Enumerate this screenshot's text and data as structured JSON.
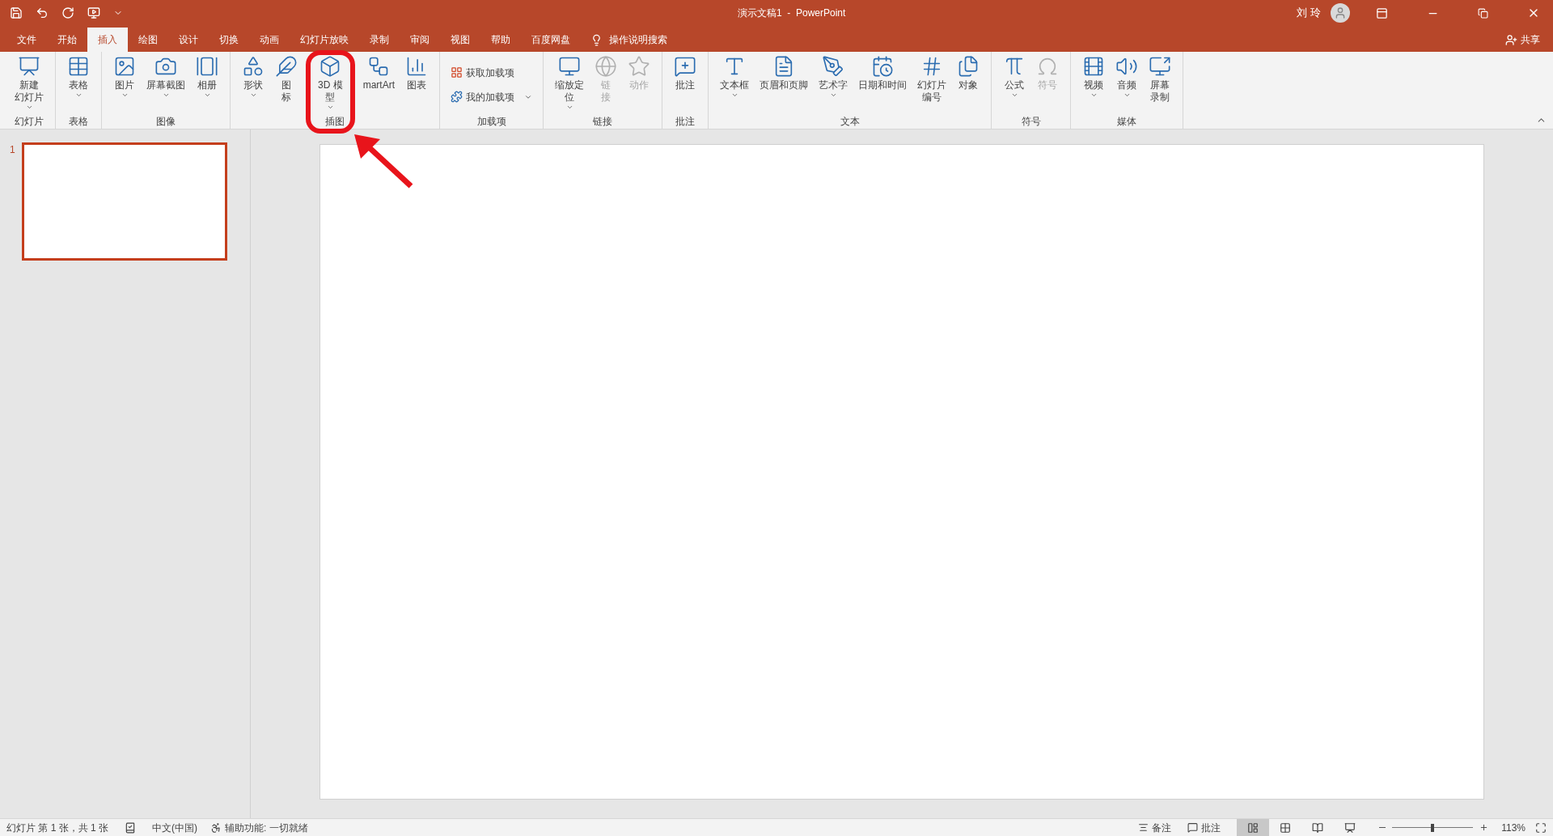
{
  "window": {
    "title": "演示文稿1  -  PowerPoint",
    "user": "刘 玲"
  },
  "tabs": [
    {
      "label": "文件",
      "selected": false
    },
    {
      "label": "开始",
      "selected": false
    },
    {
      "label": "插入",
      "selected": true
    },
    {
      "label": "绘图",
      "selected": false
    },
    {
      "label": "设计",
      "selected": false
    },
    {
      "label": "切换",
      "selected": false
    },
    {
      "label": "动画",
      "selected": false
    },
    {
      "label": "幻灯片放映",
      "selected": false
    },
    {
      "label": "录制",
      "selected": false
    },
    {
      "label": "审阅",
      "selected": false
    },
    {
      "label": "视图",
      "selected": false
    },
    {
      "label": "帮助",
      "selected": false
    },
    {
      "label": "百度网盘",
      "selected": false
    }
  ],
  "search": {
    "placeholder": "操作说明搜索"
  },
  "share": "共享",
  "ribbon": [
    {
      "label": "幻灯片",
      "buttons": [
        {
          "kind": "large",
          "lines": [
            "新建",
            "幻灯片"
          ],
          "dropdown": true,
          "disabled": false,
          "highlighted": false
        }
      ]
    },
    {
      "label": "表格",
      "buttons": [
        {
          "kind": "large",
          "lines": [
            "表格"
          ],
          "dropdown": true,
          "disabled": false,
          "highlighted": false
        }
      ]
    },
    {
      "label": "图像",
      "buttons": [
        {
          "kind": "large",
          "lines": [
            "图片"
          ],
          "dropdown": true,
          "disabled": false,
          "highlighted": false
        },
        {
          "kind": "large",
          "lines": [
            "屏幕截图"
          ],
          "dropdown": true,
          "disabled": false,
          "highlighted": false
        },
        {
          "kind": "large",
          "lines": [
            "相册"
          ],
          "dropdown": true,
          "disabled": false,
          "highlighted": false
        }
      ]
    },
    {
      "label": "插图",
      "buttons": [
        {
          "kind": "large",
          "lines": [
            "形状"
          ],
          "dropdown": true,
          "disabled": false,
          "highlighted": false
        },
        {
          "kind": "large",
          "lines": [
            "图",
            "标"
          ],
          "dropdown": false,
          "disabled": false,
          "highlighted": false
        },
        {
          "kind": "large",
          "lines": [
            "3D 模",
            "型"
          ],
          "dropdown": true,
          "disabled": false,
          "highlighted": true
        },
        {
          "kind": "large",
          "lines": [
            "martArt"
          ],
          "dropdown": false,
          "disabled": false,
          "highlighted": false
        },
        {
          "kind": "large",
          "lines": [
            "图表"
          ],
          "dropdown": false,
          "disabled": false,
          "highlighted": false
        }
      ]
    },
    {
      "label": "加载项",
      "buttons": [
        {
          "kind": "small",
          "lines": [
            "获取加载项"
          ],
          "dropdown": false,
          "disabled": false,
          "highlighted": false
        },
        {
          "kind": "small",
          "lines": [
            "我的加载项"
          ],
          "dropdown": true,
          "disabled": false,
          "highlighted": false
        }
      ]
    },
    {
      "label": "链接",
      "buttons": [
        {
          "kind": "large",
          "lines": [
            "缩放定",
            "位"
          ],
          "dropdown": true,
          "disabled": false,
          "highlighted": false
        },
        {
          "kind": "large",
          "lines": [
            "链",
            "接"
          ],
          "dropdown": false,
          "disabled": true,
          "highlighted": false
        },
        {
          "kind": "large",
          "lines": [
            "动作"
          ],
          "dropdown": false,
          "disabled": true,
          "highlighted": false
        }
      ]
    },
    {
      "label": "批注",
      "buttons": [
        {
          "kind": "large",
          "lines": [
            "批注"
          ],
          "dropdown": false,
          "disabled": false,
          "highlighted": false
        }
      ]
    },
    {
      "label": "文本",
      "buttons": [
        {
          "kind": "large",
          "lines": [
            "文本框"
          ],
          "dropdown": true,
          "disabled": false,
          "highlighted": false
        },
        {
          "kind": "large",
          "lines": [
            "页眉和页脚"
          ],
          "dropdown": false,
          "disabled": false,
          "highlighted": false
        },
        {
          "kind": "large",
          "lines": [
            "艺术字"
          ],
          "dropdown": true,
          "disabled": false,
          "highlighted": false
        },
        {
          "kind": "large",
          "lines": [
            "日期和时间"
          ],
          "dropdown": false,
          "disabled": false,
          "highlighted": false
        },
        {
          "kind": "large",
          "lines": [
            "幻灯片",
            "编号"
          ],
          "dropdown": false,
          "disabled": false,
          "highlighted": false
        },
        {
          "kind": "large",
          "lines": [
            "对象"
          ],
          "dropdown": false,
          "disabled": false,
          "highlighted": false
        }
      ]
    },
    {
      "label": "符号",
      "buttons": [
        {
          "kind": "large",
          "lines": [
            "公式"
          ],
          "dropdown": true,
          "disabled": false,
          "highlighted": false
        },
        {
          "kind": "large",
          "lines": [
            "符号"
          ],
          "dropdown": false,
          "disabled": true,
          "highlighted": false
        }
      ]
    },
    {
      "label": "媒体",
      "buttons": [
        {
          "kind": "large",
          "lines": [
            "视频"
          ],
          "dropdown": true,
          "disabled": false,
          "highlighted": false
        },
        {
          "kind": "large",
          "lines": [
            "音频"
          ],
          "dropdown": true,
          "disabled": false,
          "highlighted": false
        },
        {
          "kind": "large",
          "lines": [
            "屏幕",
            "录制"
          ],
          "dropdown": false,
          "disabled": false,
          "highlighted": false
        }
      ]
    }
  ],
  "slides": [
    {
      "number": "1",
      "selected": true
    }
  ],
  "status_bar": {
    "slide_info": "幻灯片 第 1 张，共 1 张",
    "language": "中文(中国)",
    "accessibility": "辅助功能: 一切就绪",
    "notes": "备注",
    "comments": "批注",
    "views": [
      {
        "kind": "normal",
        "selected": true
      },
      {
        "kind": "sorter",
        "selected": false
      },
      {
        "kind": "reading",
        "selected": false
      },
      {
        "kind": "show",
        "selected": false
      }
    ],
    "zoom": {
      "level": 0.5,
      "reading": "113%"
    }
  }
}
